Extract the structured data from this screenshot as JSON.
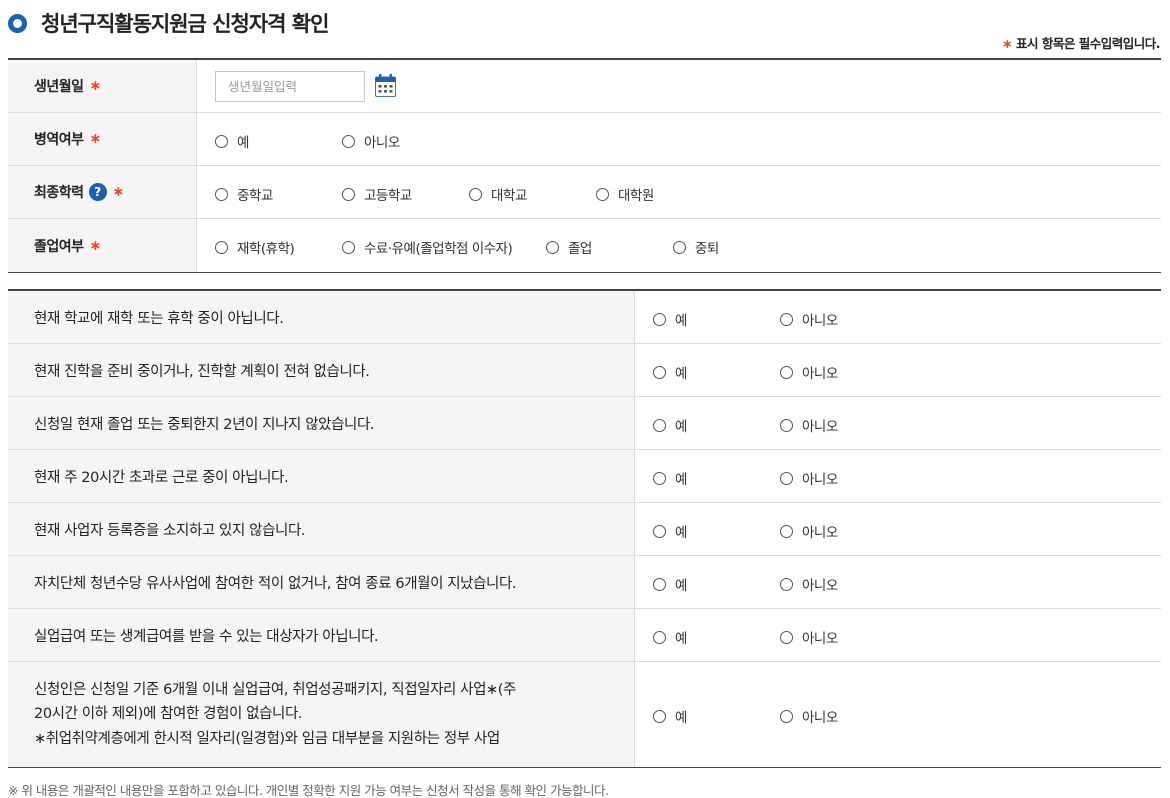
{
  "header": {
    "title": "청년구직활동지원금 신청자격 확인",
    "required_star": "∗",
    "required_note": "표시 항목은 필수입력입니다."
  },
  "basic_form": {
    "required_star": "∗",
    "birth": {
      "label": "생년월일",
      "placeholder": "생년월일입력"
    },
    "military": {
      "label": "병역여부",
      "options": [
        "예",
        "아니오"
      ]
    },
    "education": {
      "label": "최종학력",
      "help_icon": "?",
      "options": [
        "중학교",
        "고등학교",
        "대학교",
        "대학원"
      ]
    },
    "graduation": {
      "label": "졸업여부",
      "options": [
        "재학(휴학)",
        "수료·유예(졸업학점 이수자)",
        "졸업",
        "중퇴"
      ]
    }
  },
  "questions": {
    "yes_label": "예",
    "no_label": "아니오",
    "items": [
      "현재 학교에 재학 또는 휴학 중이 아닙니다.",
      "현재 진학을 준비 중이거나, 진학할 계획이 전혀 없습니다.",
      "신청일 현재 졸업 또는 중퇴한지 2년이 지나지 않았습니다.",
      "현재 주 20시간 초과로 근로 중이 아닙니다.",
      "현재 사업자 등록증을 소지하고 있지 않습니다.",
      "자치단체 청년수당 유사사업에 참여한 적이 없거나, 참여 종료 6개월이 지났습니다.",
      "실업급여 또는 생계급여를 받을 수 있는 대상자가 아닙니다."
    ],
    "last_item": {
      "line1": "신청인은 신청일 기준 6개월 이내 실업급여, 취업성공패키지, 직접일자리 사업∗(주",
      "line2": "20시간 이하 제외)에 참여한 경험이 없습니다.",
      "line3": "∗취업취약계층에게 한시적 일자리(일경험)와 임금 대부분을 지원하는 정부 사업"
    }
  },
  "footnote": "※ 위 내용은 개괄적인 내용만을 포함하고 있습니다. 개인별 정확한 지원 가능 여부는 신청서 작성을 통해 확인 가능합니다.",
  "colors": {
    "accent": "#1f5fb0",
    "required": "#e8452c"
  }
}
